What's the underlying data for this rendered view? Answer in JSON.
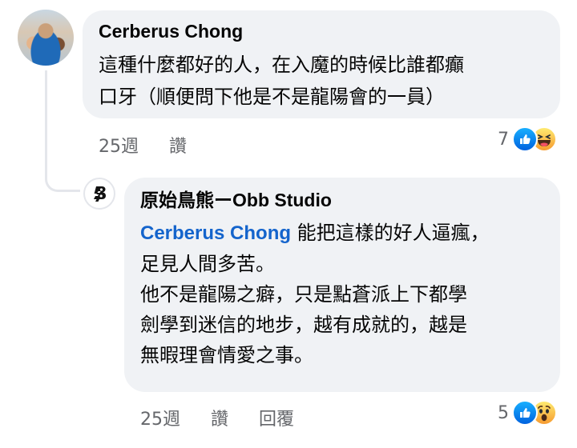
{
  "comment": {
    "author": "Cerberus Chong",
    "lines": [
      "這種什麼都好的人，在入魔的時候比誰都癲",
      "口牙（順便問下他是不是龍陽會的一員）"
    ],
    "time": "25週",
    "like_label": "讚",
    "reaction_count": "7",
    "reaction_icons": [
      "like-icon",
      "haha-icon"
    ]
  },
  "reply": {
    "author": "原始鳥熊ーObb Studio",
    "mention": "Cerberus Chong",
    "first_line_rest": " 能把這樣的好人逼瘋，",
    "lines": [
      "足見人間多苦。",
      "他不是龍陽之癖，只是點蒼派上下都學",
      "劍學到迷信的地步，越有成就的，越是",
      "無暇理會情愛之事。"
    ],
    "time": "25週",
    "like_label": "讚",
    "reply_label": "回覆",
    "reaction_count": "5",
    "reaction_icons": [
      "like-icon",
      "wow-icon"
    ]
  },
  "colors": {
    "bubble": "#f0f2f5",
    "mention": "#1464cc",
    "meta": "#65676b",
    "like": "#0866ff"
  }
}
